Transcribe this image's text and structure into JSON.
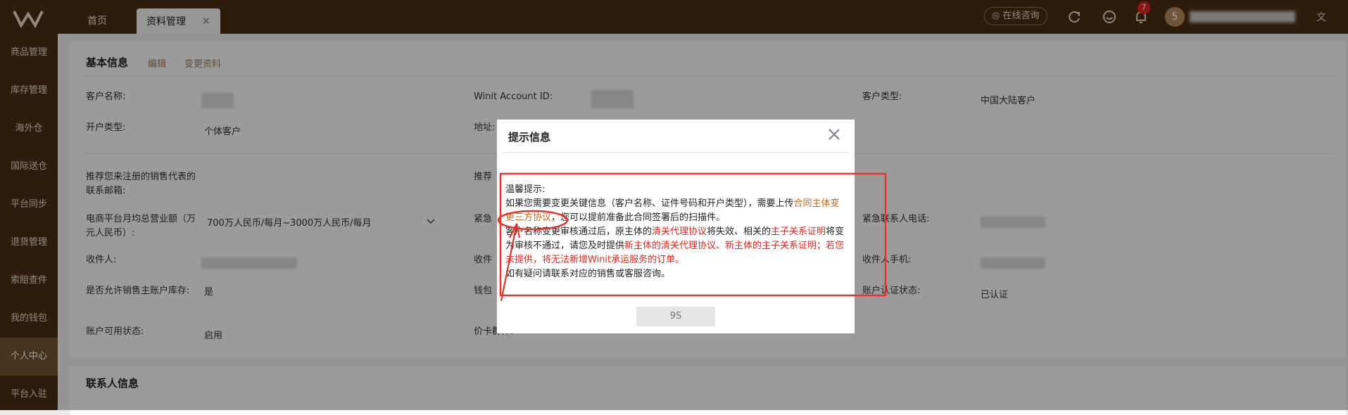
{
  "header": {
    "tabs": [
      {
        "label": "首页"
      },
      {
        "label": "资料管理",
        "close": "✕"
      }
    ],
    "consult_label": "在线咨询",
    "notification_count": "7",
    "avatar_initial": "5"
  },
  "sidebar": {
    "items": [
      {
        "label": "商品管理"
      },
      {
        "label": "库存管理"
      },
      {
        "label": "海外仓"
      },
      {
        "label": "国际送仓"
      },
      {
        "label": "平台同步"
      },
      {
        "label": "退货管理"
      },
      {
        "label": "索赔查件"
      },
      {
        "label": "我的钱包"
      },
      {
        "label": "个人中心",
        "active": true
      },
      {
        "label": "平台入驻"
      }
    ]
  },
  "basic_info": {
    "title": "基本信息",
    "edit_link": "编辑",
    "change_link": "变更资料",
    "labels": {
      "customer_name": "客户名称:",
      "winit_id": "Winit Account ID:",
      "customer_type": "客户类型:",
      "account_type": "开户类型:",
      "address": "地址:",
      "referral_email": "推荐您来注册的销售代表的联系邮箱:",
      "referral_partial": "推荐",
      "monthly_revenue": "电商平台月均总营业额（万元人民币）:",
      "emergency_partial": "紧急",
      "emergency_phone": "紧急联系人电话:",
      "receiver": "收件人:",
      "receiver_partial": "收件",
      "receiver_mobile": "收件人手机:",
      "allow_subaccount": "是否允许销售主账户库存:",
      "wallet_partial": "钱包",
      "account_verify": "账户认证状态:",
      "account_status": "账户可用状态:",
      "price_card_partial": "价卡群体:"
    },
    "values": {
      "customer_type": "中国大陆客户",
      "account_type": "个体客户",
      "monthly_revenue": "700万人民币/每月~3000万人民币/每月",
      "allow_subaccount": "是",
      "account_verify": "已认证",
      "account_status": "启用"
    }
  },
  "contact_info": {
    "title": "联系人信息"
  },
  "modal": {
    "title": "提示信息",
    "line1": "温馨提示:",
    "p1_a": "如果您需要变更关键信息（客户名称、证件号码和开户类型），需要上传",
    "p1_b": "合同主体变更三方协议",
    "p1_c": "，您可以提前准备此合同签署后的扫描件。",
    "p2_a": "客户名称变更审核通过后，原主体的",
    "p2_b": "清关代理协议",
    "p2_c": "将失效、相关的",
    "p2_d": "主子关系证明",
    "p2_e": "将变为审核不通过，请您及时提供",
    "p2_f": "新主体的清关代理协议、新主体的主子关系证明；若您未提供，将无法新增Winit承运服务的订单。",
    "p3": "如有疑问请联系对应的销售或客服咨询。",
    "countdown": "9S"
  }
}
